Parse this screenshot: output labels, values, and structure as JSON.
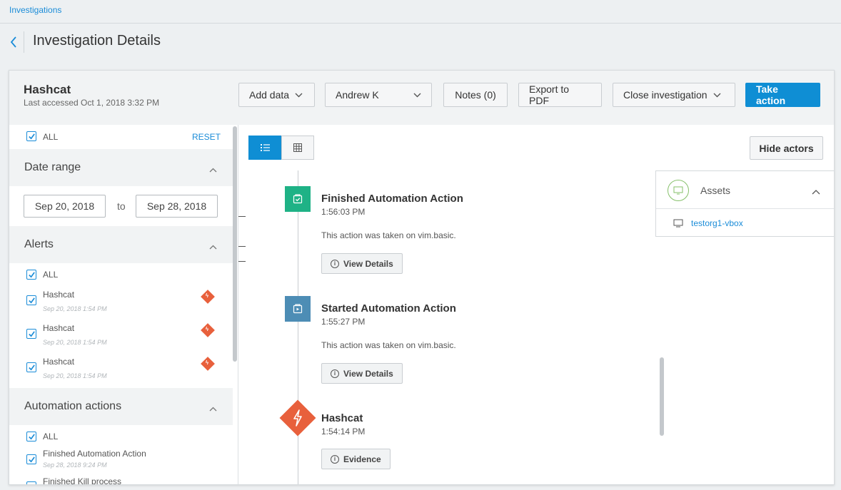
{
  "breadcrumb": "Investigations",
  "page_title": "Investigation Details",
  "investigation": {
    "name": "Hashcat",
    "last_accessed": "Last accessed Oct 1, 2018 3:32 PM"
  },
  "toolbar": {
    "add_data": "Add data",
    "assignee": "Andrew K",
    "notes": "Notes (0)",
    "export": "Export to PDF",
    "close": "Close investigation",
    "take_action": "Take action"
  },
  "filters": {
    "all_label": "ALL",
    "reset_label": "RESET",
    "date_range": {
      "title": "Date range",
      "from": "Sep 20, 2018",
      "to_label": "to",
      "to": "Sep 28, 2018"
    },
    "alerts": {
      "title": "Alerts",
      "all_label": "ALL",
      "items": [
        {
          "name": "Hashcat",
          "date": "Sep 20, 2018 1:54 PM"
        },
        {
          "name": "Hashcat",
          "date": "Sep 20, 2018 1:54 PM"
        },
        {
          "name": "Hashcat",
          "date": "Sep 20, 2018 1:54 PM"
        }
      ]
    },
    "automation": {
      "title": "Automation actions",
      "all_label": "ALL",
      "items": [
        {
          "name": "Finished Automation Action",
          "date": "Sep 28, 2018 9:24 PM"
        },
        {
          "name": "Finished Kill process",
          "date": ""
        }
      ]
    }
  },
  "main": {
    "hide_actors": "Hide actors",
    "events": [
      {
        "title": "Finished Automation Action",
        "time": "1:56:03 PM",
        "desc": "This action was taken on vim.basic.",
        "button": "View Details",
        "color": "#1fb286"
      },
      {
        "title": "Started Automation Action",
        "time": "1:55:27 PM",
        "desc": "This action was taken on vim.basic.",
        "button": "View Details",
        "color": "#4d8db5"
      },
      {
        "title": "Hashcat",
        "time": "1:54:14 PM",
        "desc": "",
        "button": "Evidence",
        "color": "#e8603c"
      }
    ],
    "assets": {
      "title": "Assets",
      "items": [
        "testorg1-vbox"
      ]
    }
  }
}
